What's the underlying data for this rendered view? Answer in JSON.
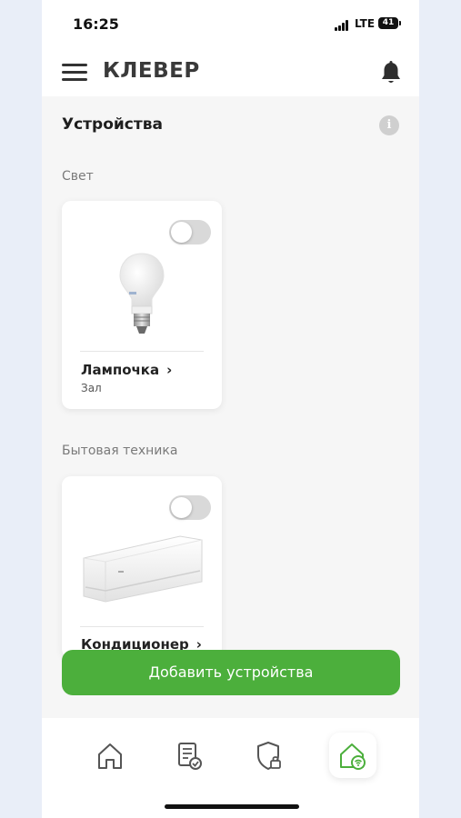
{
  "status_bar": {
    "time": "16:25",
    "network": "LTE",
    "battery": "41"
  },
  "header": {
    "brand": "КЛЕВЕР",
    "menu_icon": "menu-icon",
    "bell_icon": "bell-icon"
  },
  "devices": {
    "title": "Устройства",
    "info_icon": "i",
    "categories": [
      {
        "label": "Свет",
        "device": {
          "name": "Лампочка",
          "chevron": "›",
          "room": "Зал",
          "toggle_on": false,
          "image": "light-bulb"
        }
      },
      {
        "label": "Бытовая техника",
        "device": {
          "name": "Кондиционер",
          "chevron": "›",
          "toggle_on": false,
          "image": "air-conditioner"
        }
      }
    ]
  },
  "add_button": {
    "label": "Добавить устройства"
  },
  "tab_bar": {
    "tabs": [
      {
        "icon": "home-icon",
        "active": false
      },
      {
        "icon": "document-check-icon",
        "active": false
      },
      {
        "icon": "shield-lock-icon",
        "active": false
      },
      {
        "icon": "smart-home-wifi-icon",
        "active": true
      }
    ]
  },
  "colors": {
    "accent": "#4caf3c",
    "background": "#f6f6f6",
    "toggle_off": "#d9d9d9"
  }
}
